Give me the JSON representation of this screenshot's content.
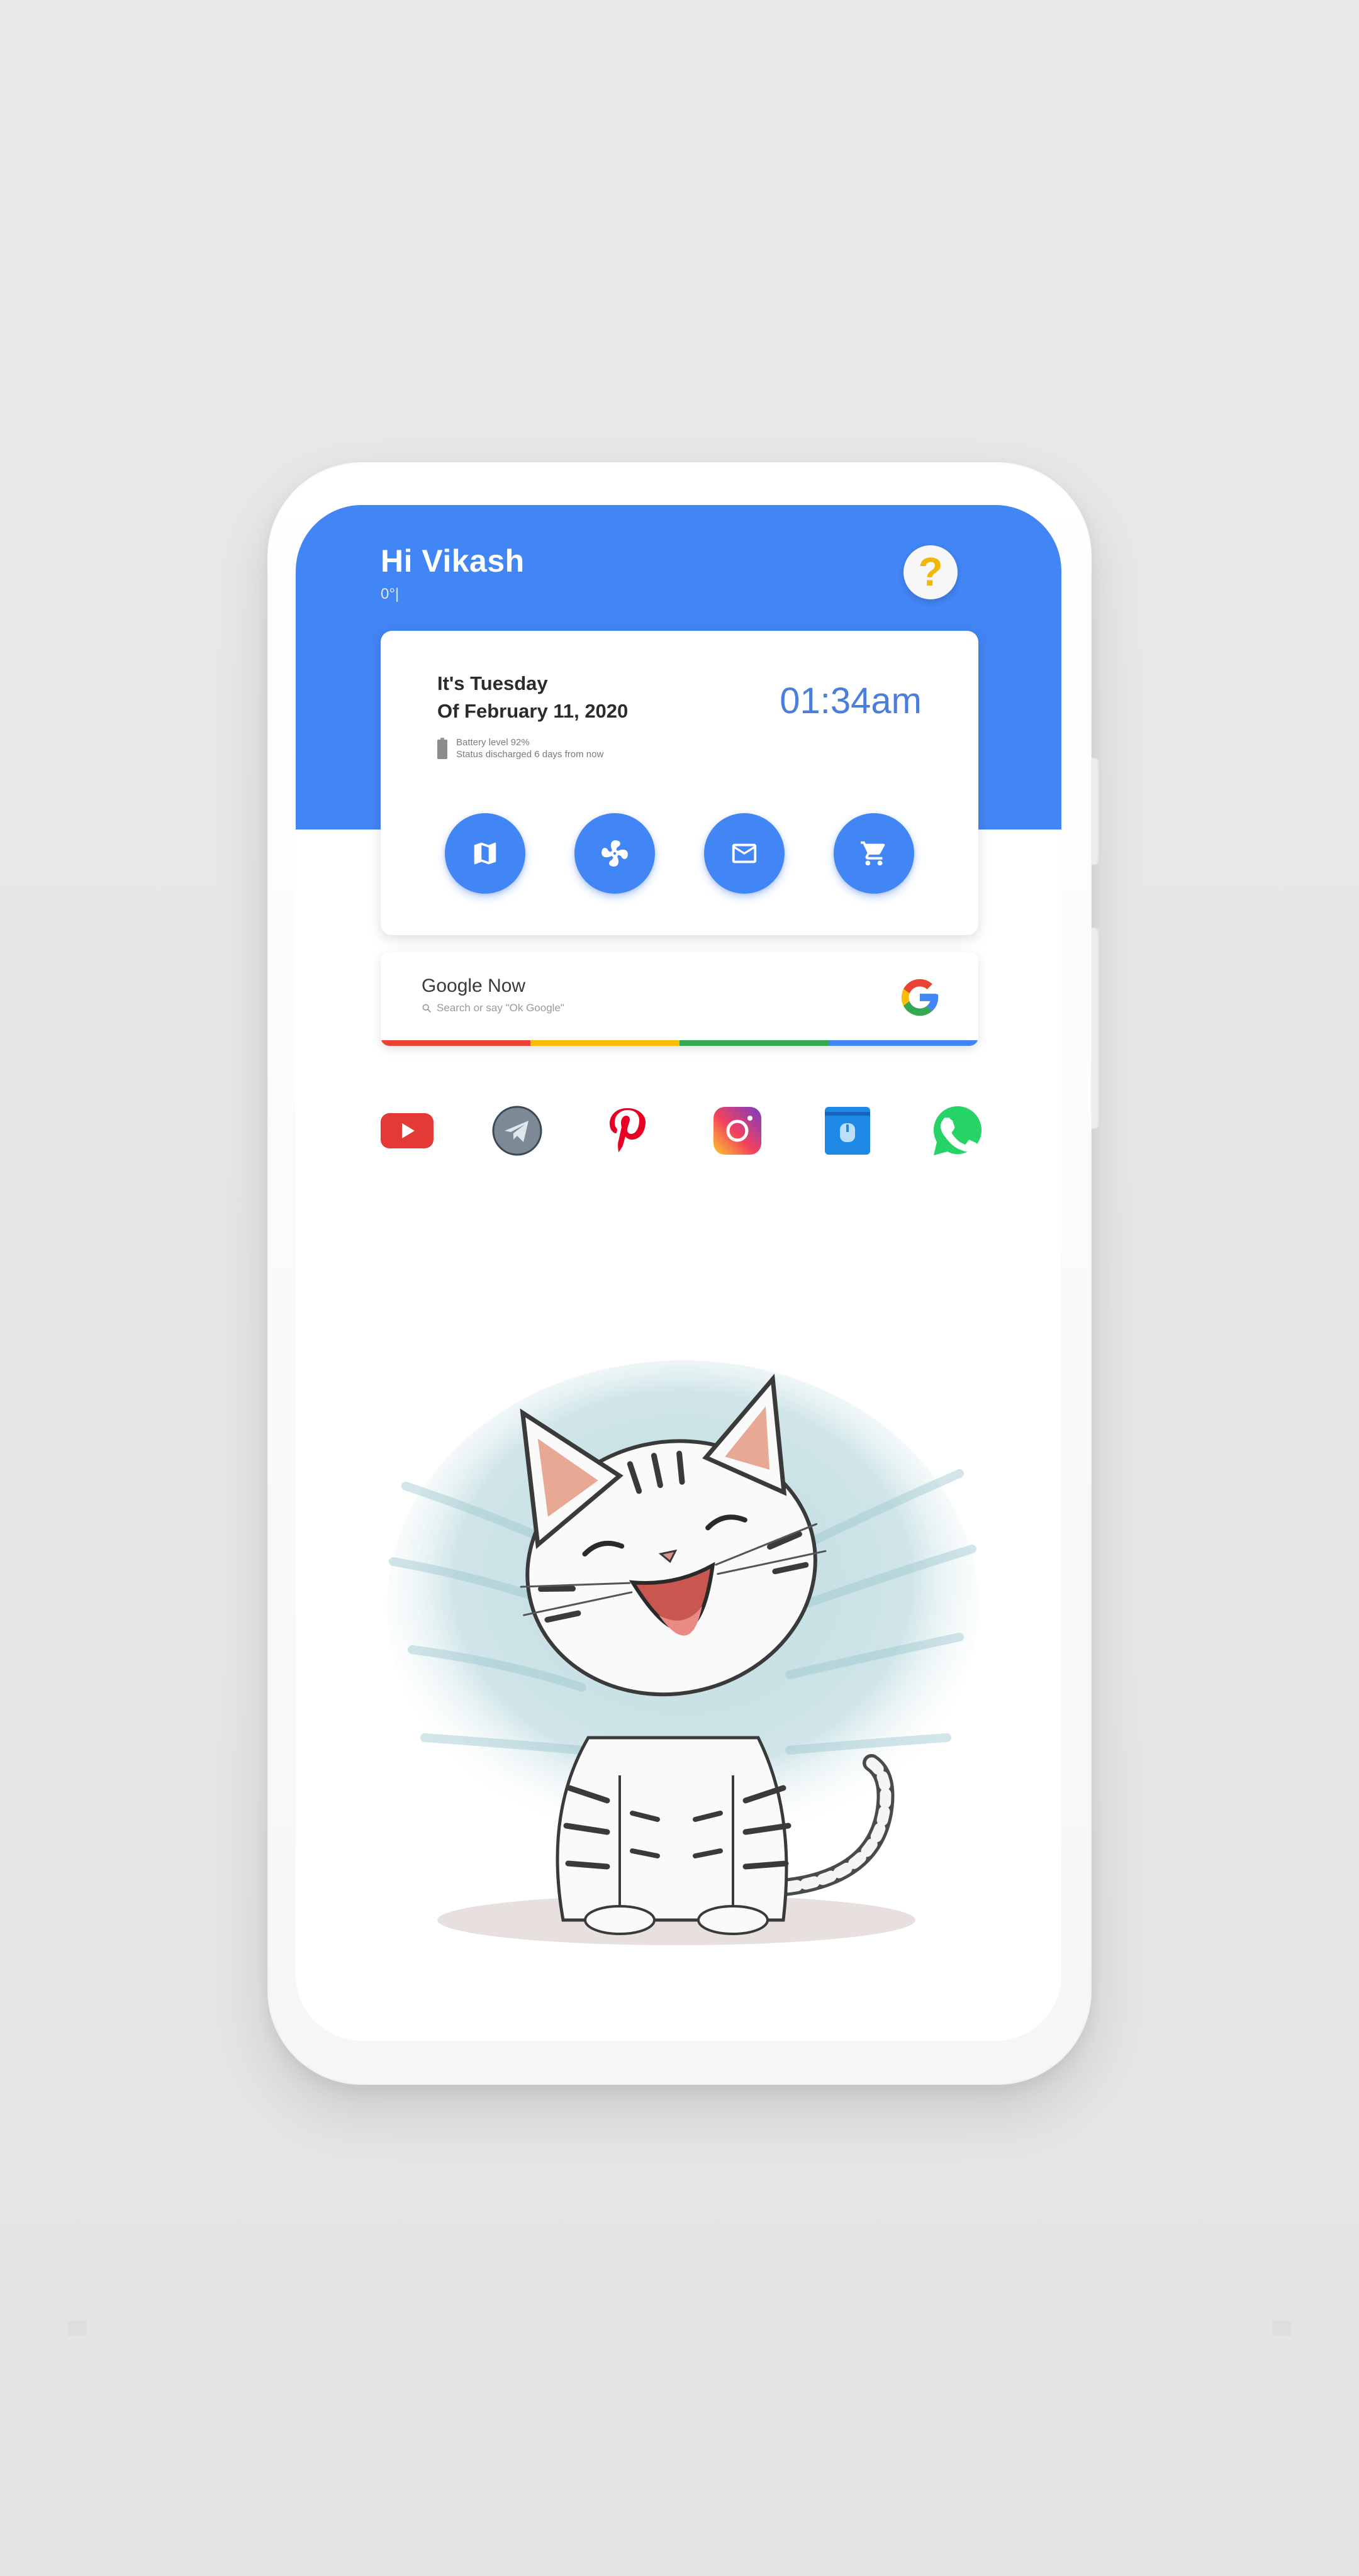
{
  "header": {
    "greeting": "Hi Vikash",
    "temperature": "0°|",
    "help_icon": "question-mark-icon",
    "accent_color": "#4285f4"
  },
  "clock_card": {
    "day_text": "It's Tuesday",
    "date_text": "Of February 11, 2020",
    "time": "01:34am",
    "battery_level": "Battery level 92%",
    "battery_status": "Status discharged 6 days from now",
    "quick_actions": [
      {
        "icon": "map-icon"
      },
      {
        "icon": "fan-icon"
      },
      {
        "icon": "mail-icon"
      },
      {
        "icon": "cart-icon"
      }
    ]
  },
  "search": {
    "title": "Google Now",
    "placeholder": "Search or say \"Ok Google\"",
    "bar_colors": [
      "#ea4335",
      "#fbbc05",
      "#34a853",
      "#4285f4"
    ]
  },
  "dock_apps": [
    {
      "icon": "youtube-icon"
    },
    {
      "icon": "telegram-icon"
    },
    {
      "icon": "pinterest-icon"
    },
    {
      "icon": "instagram-icon"
    },
    {
      "icon": "files-icon"
    },
    {
      "icon": "whatsapp-icon"
    }
  ],
  "wallpaper": {
    "subject": "kitten-illustration"
  }
}
